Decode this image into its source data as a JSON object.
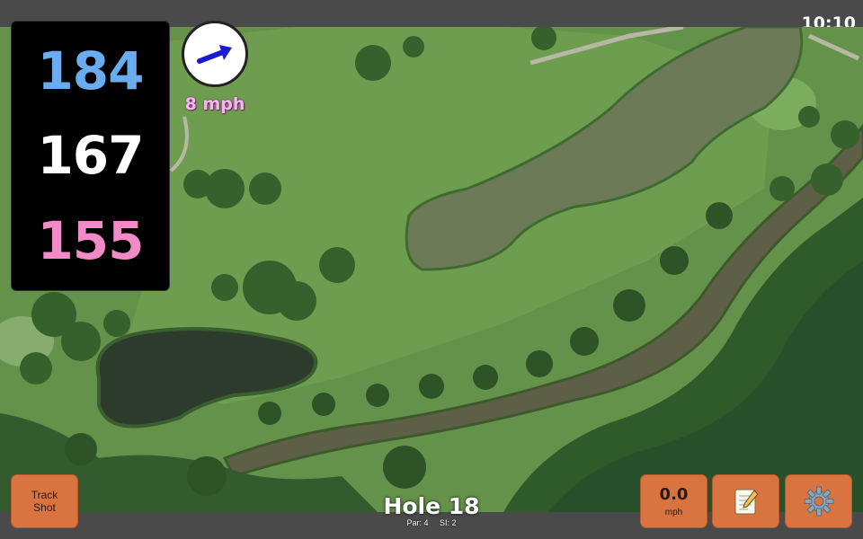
{
  "status": {
    "time": "10:10"
  },
  "yardage": {
    "back": "184",
    "center": "167",
    "front": "155",
    "back_color": "#6aacf0",
    "center_color": "#ffffff",
    "front_color": "#f28ac8"
  },
  "wind": {
    "speed_label": "8 mph",
    "icon": "wind-arrow-icon"
  },
  "buttons": {
    "track_shot_line1": "Track",
    "track_shot_line2": "Shot",
    "speed_value": "0.0",
    "speed_unit": "mph",
    "notes_icon": "notepad-icon",
    "settings_icon": "gear-icon"
  },
  "hole": {
    "title": "Hole 18",
    "par": "Par: 4",
    "si": "SI: 2"
  },
  "colors": {
    "accent_orange": "#d9733f",
    "panel_black": "#000000"
  }
}
